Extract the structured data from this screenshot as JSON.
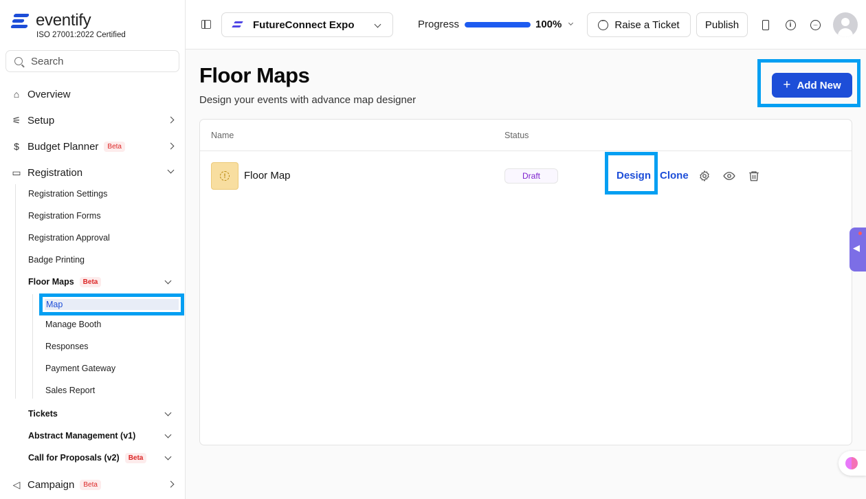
{
  "brand": {
    "name": "eventify",
    "certification": "ISO 27001:2022 Certified"
  },
  "search": {
    "placeholder": "Search"
  },
  "sidebar": {
    "overview": "Overview",
    "setup": "Setup",
    "budget_planner": "Budget Planner",
    "beta": "Beta",
    "registration": "Registration",
    "registration_items": [
      "Registration Settings",
      "Registration Forms",
      "Registration Approval",
      "Badge Printing"
    ],
    "floor_maps": "Floor Maps",
    "floor_map_items": [
      "Map",
      "Manage Booth",
      "Responses",
      "Payment Gateway",
      "Sales Report"
    ],
    "tickets": "Tickets",
    "abstract_management": "Abstract Management (v1)",
    "call_for_proposals": "Call for Proposals (v2)",
    "campaign": "Campaign"
  },
  "header": {
    "event_name": "FutureConnect Expo",
    "progress_label": "Progress",
    "progress_value": 100,
    "progress_text": "100%",
    "raise_ticket": "Raise a Ticket",
    "publish": "Publish"
  },
  "main": {
    "title": "Floor Maps",
    "subtitle": "Design your events with advance map designer",
    "add_new": "Add New",
    "columns": [
      "Name",
      "Status"
    ],
    "rows": [
      {
        "name": "Floor Map",
        "status": "Draft",
        "actions": [
          "Design",
          "Clone"
        ]
      }
    ]
  },
  "colors": {
    "accent": "#1d4ed8",
    "highlight": "#049ff2",
    "status_draft": "#7e22ce",
    "beta": "#dc2626"
  }
}
